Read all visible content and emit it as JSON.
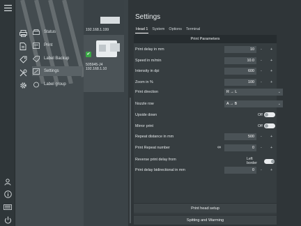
{
  "rail": {
    "icons": [
      "menu-icon",
      "user-icon",
      "info-icon",
      "keyboard-icon",
      "power-icon"
    ]
  },
  "nav": {
    "items": [
      {
        "label": "Status",
        "icon": "printer-icon"
      },
      {
        "label": "Print",
        "icon": "document-icon"
      },
      {
        "label": "Label Backup",
        "icon": "label-icon"
      },
      {
        "label": "Settings",
        "icon": "tools-icon"
      },
      {
        "label": "Label group",
        "icon": "gear-icon"
      }
    ],
    "active_index": 3
  },
  "devices": [
    {
      "name": "",
      "ip": "192.168.1.199"
    },
    {
      "name": "505945-J4",
      "ip": "192.168.1.10"
    }
  ],
  "settings": {
    "title": "Settings",
    "tabs": [
      "Head 1",
      "System",
      "Options",
      "Terminal"
    ],
    "active_tab": 0,
    "section_title": "Print Parameters",
    "rows": [
      {
        "label": "Print delay in mm",
        "value": "10",
        "kind": "number"
      },
      {
        "label": "Speed in m/min",
        "value": "10.0",
        "kind": "number"
      },
      {
        "label": "Intensity in dpi",
        "value": "600",
        "kind": "number"
      },
      {
        "label": "Zoom in %",
        "value": "100",
        "kind": "number"
      },
      {
        "label": "Print direction",
        "value": "R → L",
        "kind": "select"
      },
      {
        "label": "Nozzle row",
        "value": "A → B",
        "kind": "select"
      },
      {
        "label": "Upside down",
        "value": "Off",
        "kind": "toggle"
      },
      {
        "label": "Mirror print",
        "value": "Off",
        "kind": "toggle"
      },
      {
        "label": "Repeat distance in mm",
        "value": "500",
        "kind": "number"
      },
      {
        "label": "Print Repeat number",
        "value": "0",
        "kind": "number-loop"
      },
      {
        "label": "Reverse print delay from",
        "value": "Left border",
        "kind": "toggle"
      },
      {
        "label": "Print delay bidirectional in mm",
        "value": "0",
        "kind": "number"
      }
    ],
    "stepper_minus": "-",
    "stepper_plus": "+",
    "caret": "⌄",
    "loop_symbol": "∞",
    "buttons": {
      "head_setup": "Print head setup",
      "spitting": "Spitting and Warming"
    }
  }
}
